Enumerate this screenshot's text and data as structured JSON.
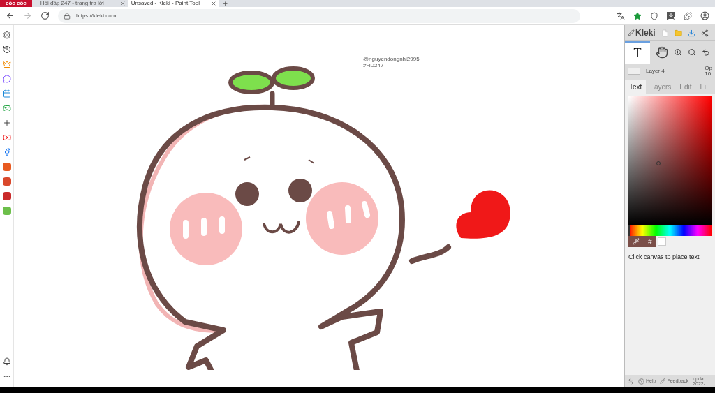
{
  "browser": {
    "logo": "cốc cốc",
    "tabs": [
      {
        "title": "Hỏi đáp 247 - trang tra lời",
        "selected": false
      },
      {
        "title": "Unsaved - Kleki - Paint Tool",
        "selected": true
      }
    ],
    "address": "https://kleki.com"
  },
  "canvas": {
    "signature": [
      "@nguyendongnhi2995",
      "#HD247"
    ]
  },
  "panel": {
    "brand": "Kleki",
    "text_tool": "T",
    "layer": "Layer 4",
    "opacity_label": "Op",
    "opacity_value": "10",
    "tabs": [
      {
        "label": "Text",
        "selected": true
      },
      {
        "label": "Layers",
        "selected": false
      },
      {
        "label": "Edit",
        "selected": false
      },
      {
        "label": "Fi",
        "selected": false
      }
    ],
    "hue": {
      "level": 0
    },
    "hex_button": "#",
    "hint": "Click canvas to place text",
    "footer": {
      "help": "Help",
      "feedback": "Feedback",
      "update": "upda",
      "date": "2022-"
    }
  }
}
